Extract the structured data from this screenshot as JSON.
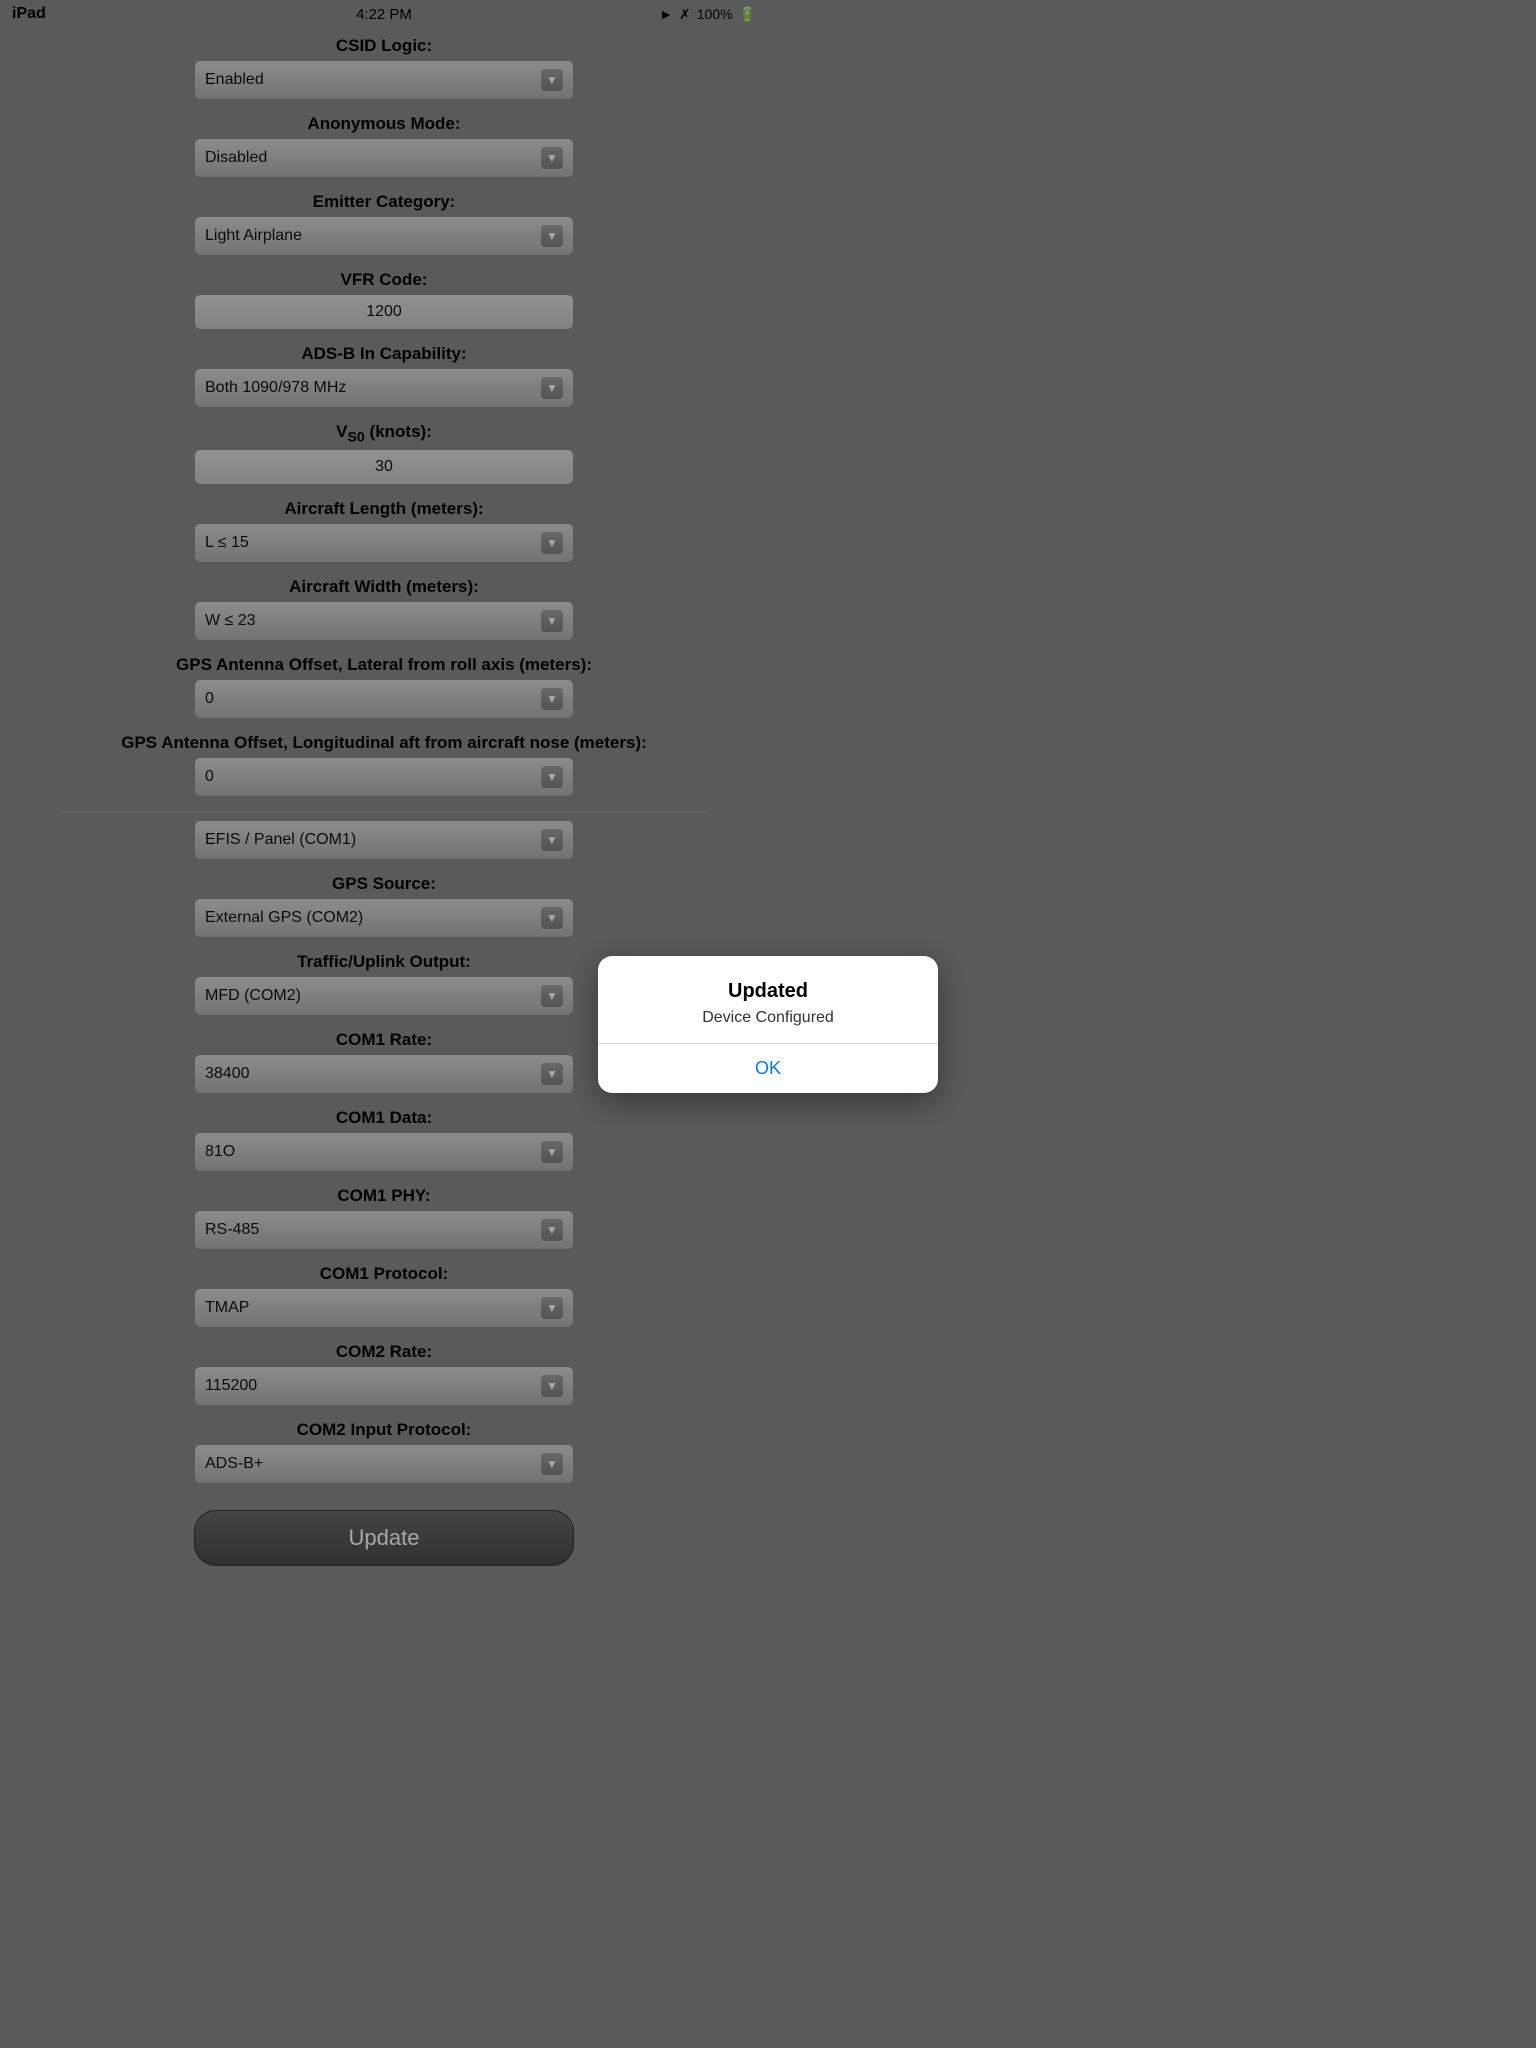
{
  "statusBar": {
    "deviceName": "iPad",
    "time": "4:22 PM",
    "battery": "100%",
    "batteryCharging": true
  },
  "fields": [
    {
      "id": "csid-logic",
      "label": "CSID Logic:",
      "type": "dropdown",
      "value": "Enabled"
    },
    {
      "id": "anonymous-mode",
      "label": "Anonymous Mode:",
      "type": "dropdown",
      "value": "Disabled"
    },
    {
      "id": "emitter-category",
      "label": "Emitter Category:",
      "type": "dropdown",
      "value": "Light Airplane"
    },
    {
      "id": "vfr-code",
      "label": "VFR Code:",
      "type": "input",
      "value": "1200"
    },
    {
      "id": "adsb-in-capability",
      "label": "ADS-B In Capability:",
      "type": "dropdown",
      "value": "Both 1090/978 MHz"
    },
    {
      "id": "vs0-knots",
      "label": "VS0 (knots):",
      "type": "input",
      "value": "30",
      "subscript": true
    },
    {
      "id": "aircraft-length",
      "label": "Aircraft Length (meters):",
      "type": "dropdown",
      "value": "L ≤ 15"
    },
    {
      "id": "aircraft-width",
      "label": "Aircraft Width (meters):",
      "type": "dropdown",
      "value": "W ≤ 23"
    },
    {
      "id": "gps-lateral",
      "label": "GPS Antenna Offset, Lateral from roll axis (meters):",
      "type": "dropdown",
      "value": "0"
    },
    {
      "id": "gps-longitudinal",
      "label": "GPS Antenna Offset, Longitudinal aft from aircraft nose (meters):",
      "type": "dropdown",
      "value": "0"
    }
  ],
  "fieldsBelow": [
    {
      "id": "efis-panel",
      "label": "",
      "type": "dropdown",
      "value": "EFIS / Panel (COM1)"
    },
    {
      "id": "gps-source",
      "label": "GPS Source:",
      "type": "dropdown",
      "value": "External GPS (COM2)"
    },
    {
      "id": "traffic-uplink",
      "label": "Traffic/Uplink Output:",
      "type": "dropdown",
      "value": "MFD (COM2)"
    },
    {
      "id": "com1-rate",
      "label": "COM1 Rate:",
      "type": "dropdown",
      "value": "38400"
    },
    {
      "id": "com1-data",
      "label": "COM1 Data:",
      "type": "dropdown",
      "value": "81O"
    },
    {
      "id": "com1-phy",
      "label": "COM1 PHY:",
      "type": "dropdown",
      "value": "RS-485"
    },
    {
      "id": "com1-protocol",
      "label": "COM1 Protocol:",
      "type": "dropdown",
      "value": "TMAP"
    },
    {
      "id": "com2-rate",
      "label": "COM2 Rate:",
      "type": "dropdown",
      "value": "115200"
    },
    {
      "id": "com2-input-protocol",
      "label": "COM2 Input Protocol:",
      "type": "dropdown",
      "value": "ADS-B+"
    }
  ],
  "modal": {
    "title": "Updated",
    "message": "Device Configured",
    "okLabel": "OK"
  },
  "updateButton": {
    "label": "Update"
  }
}
